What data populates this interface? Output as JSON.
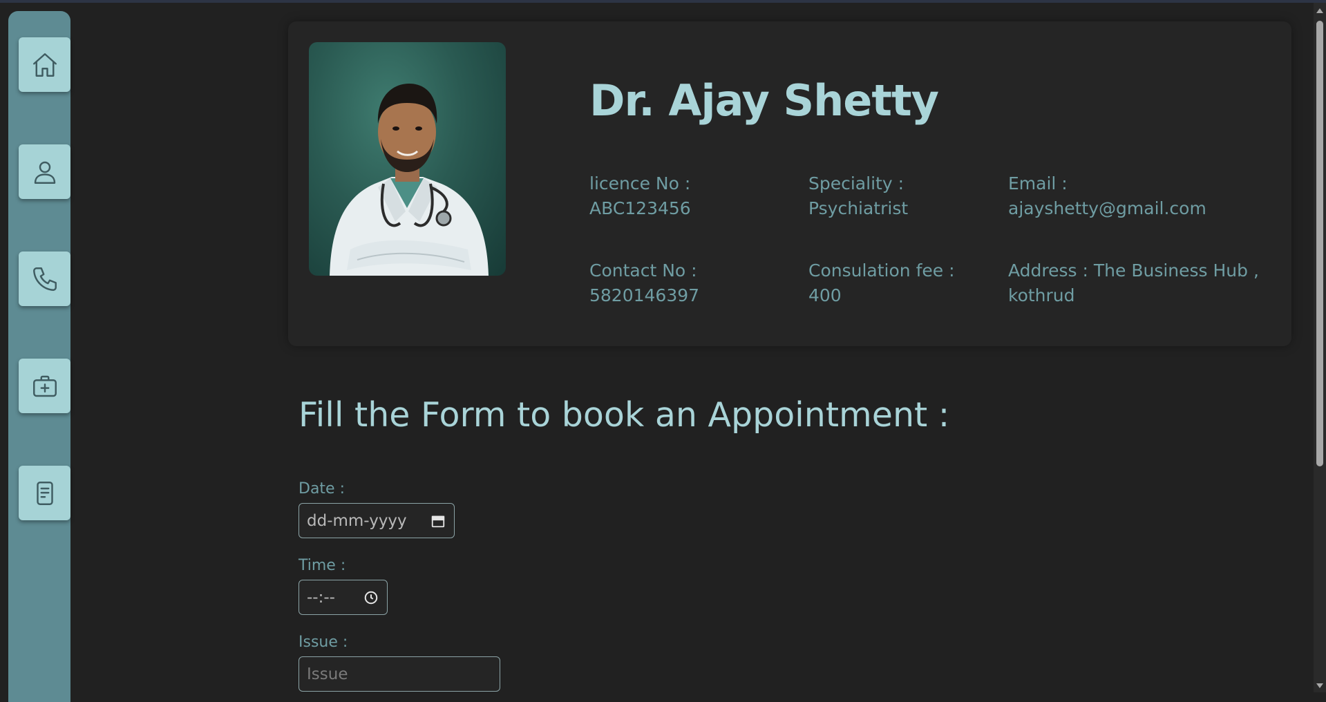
{
  "sidebar": {
    "items": [
      {
        "icon": "home-icon"
      },
      {
        "icon": "user-icon"
      },
      {
        "icon": "phone-icon"
      },
      {
        "icon": "medical-kit-icon"
      },
      {
        "icon": "document-icon"
      }
    ]
  },
  "doctor": {
    "name": "Dr. Ajay Shetty",
    "licence_label": "licence No :",
    "licence_value": "ABC123456",
    "speciality_label": "Speciality :",
    "speciality_value": "Psychiatrist",
    "email_label": "Email :",
    "email_value": "ajayshetty@gmail.com",
    "contact_label": "Contact No :",
    "contact_value": "5820146397",
    "fee_label": "Consulation fee :",
    "fee_value": "400",
    "address_line1": "Address : The Business Hub ,",
    "address_line2": "kothrud"
  },
  "form": {
    "title": "Fill the Form to book an Appointment :",
    "date_label": "Date :",
    "date_placeholder": "dd-mm-yyyy",
    "time_label": "Time :",
    "time_placeholder": "--:--",
    "issue_label": "Issue :",
    "issue_placeholder": "Issue"
  },
  "colors": {
    "background": "#212121",
    "sidebar": "#5e8b93",
    "nav_button": "#a6d3d6",
    "accent_text": "#a9d4d8",
    "muted_text": "#6f9da3"
  }
}
